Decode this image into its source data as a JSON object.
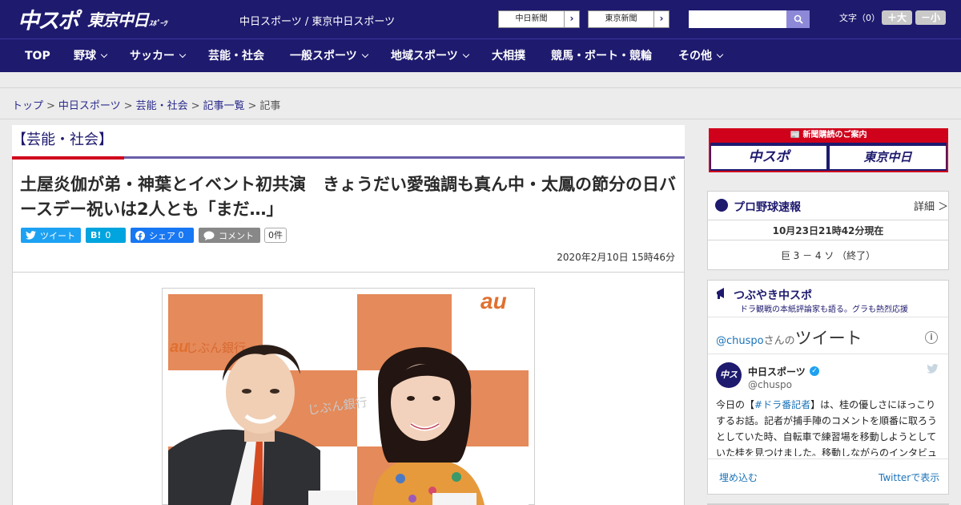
{
  "header": {
    "logo_main": "中スポ",
    "logo_sub": "東京中日",
    "logo_small": "ｽﾎﾟｰﾂ",
    "site_title": "中日スポーツ / 東京中日スポーツ",
    "paper_links": [
      "中日新聞",
      "東京新聞"
    ],
    "search_placeholder": "",
    "font_size_label": "文字（0）",
    "font_bigger": "＋大",
    "font_smaller": "－小"
  },
  "nav": {
    "items": [
      {
        "label": "TOP",
        "has_menu": false
      },
      {
        "label": "野球",
        "has_menu": true
      },
      {
        "label": "サッカー",
        "has_menu": true
      },
      {
        "label": "芸能・社会",
        "has_menu": false
      },
      {
        "label": "一般スポーツ",
        "has_menu": true
      },
      {
        "label": "地域スポーツ",
        "has_menu": true
      },
      {
        "label": "大相撲",
        "has_menu": false
      },
      {
        "label": "競馬・ボート・競輪",
        "has_menu": false
      },
      {
        "label": "その他",
        "has_menu": true
      }
    ]
  },
  "breadcrumb": {
    "items": [
      "トップ",
      "中日スポーツ",
      "芸能・社会",
      "記事一覧"
    ],
    "current": "記事"
  },
  "article": {
    "category": "【芸能・社会】",
    "headline": "土屋炎伽が弟・神葉とイベント初共演　きょうだい愛強調も真ん中・太鳳の節分の日バースデー祝いは2人とも「まだ…」",
    "share": {
      "tweet": "ツイート",
      "hatena_icon": "B!",
      "hatena_count": "0",
      "facebook": "シェア",
      "facebook_count": "0",
      "comment": "コメント",
      "comment_count": "0件"
    },
    "date": "2020年2月10日 15時46分",
    "photo_bank_text": "じぶん銀行",
    "photo_logo_text": "au"
  },
  "sidebar": {
    "subscribe": {
      "title": "新聞購読のご案内",
      "btn1": "中スポ",
      "btn2": "東京中日"
    },
    "baseball": {
      "title": "プロ野球速報",
      "detail": "詳細 ＞",
      "updated": "10月23日21時42分現在",
      "game": "巨 3 － 4 ソ （終了）"
    },
    "tweets": {
      "title": "つぶやき中スポ",
      "subtitle": "ドラ観戦の本紙評論家も語る。グラも熱烈応援",
      "handle": "@chuspo",
      "handle_suffix": "さんの",
      "heading": "ツイート",
      "account_name": "中日スポーツ",
      "account_user": "@chuspo",
      "tweet_pre": "今日の【",
      "tweet_hash": "#ドラ番記者",
      "tweet_post": "】は、桂の優しさにほっこりするお話。記者が捕手陣のコメントを順番に取ろうとしていた時、自転車で練習場を移動しようとしていた桂を見つけました。移動しながらのインタビュ",
      "embed": "埋め込む",
      "view_on_twitter": "Twitterで表示"
    }
  },
  "colors": {
    "brand_navy": "#1e1a6e",
    "accent_red": "#d0011b",
    "twitter_blue": "#1da1f2",
    "facebook_blue": "#1877f2",
    "hatena_blue": "#00a4de"
  }
}
